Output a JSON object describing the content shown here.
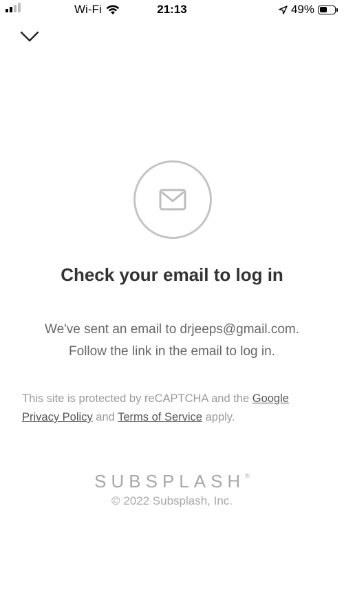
{
  "status_bar": {
    "carrier": "Wi-Fi",
    "time": "21:13",
    "battery": "49%",
    "battery_level": 0.49,
    "icons": [
      "signal-bars-icon",
      "wifi-icon",
      "location-arrow-icon",
      "battery-icon"
    ]
  },
  "nav": {
    "close_icon": "chevron-down-icon"
  },
  "main": {
    "icon": "envelope-icon",
    "title": "Check your email to log in",
    "message_line1": "We've sent an email to drjeeps@gmail.com.",
    "message_line2": "Follow the link in the email to log in."
  },
  "recaptcha": {
    "prefix": "This site is protected by reCAPTCHA and the",
    "privacy_link": "Google Privacy Policy",
    "and": "and",
    "terms_link": "Terms of Service",
    "suffix": "apply."
  },
  "footer": {
    "brand": "SUBSPLASH",
    "brand_mark": "®",
    "copyright": "© 2022 Subsplash, Inc."
  },
  "colors": {
    "circle_border": "#c4c4c4",
    "title_text": "#333333",
    "muted_text": "#9a9a9a"
  }
}
